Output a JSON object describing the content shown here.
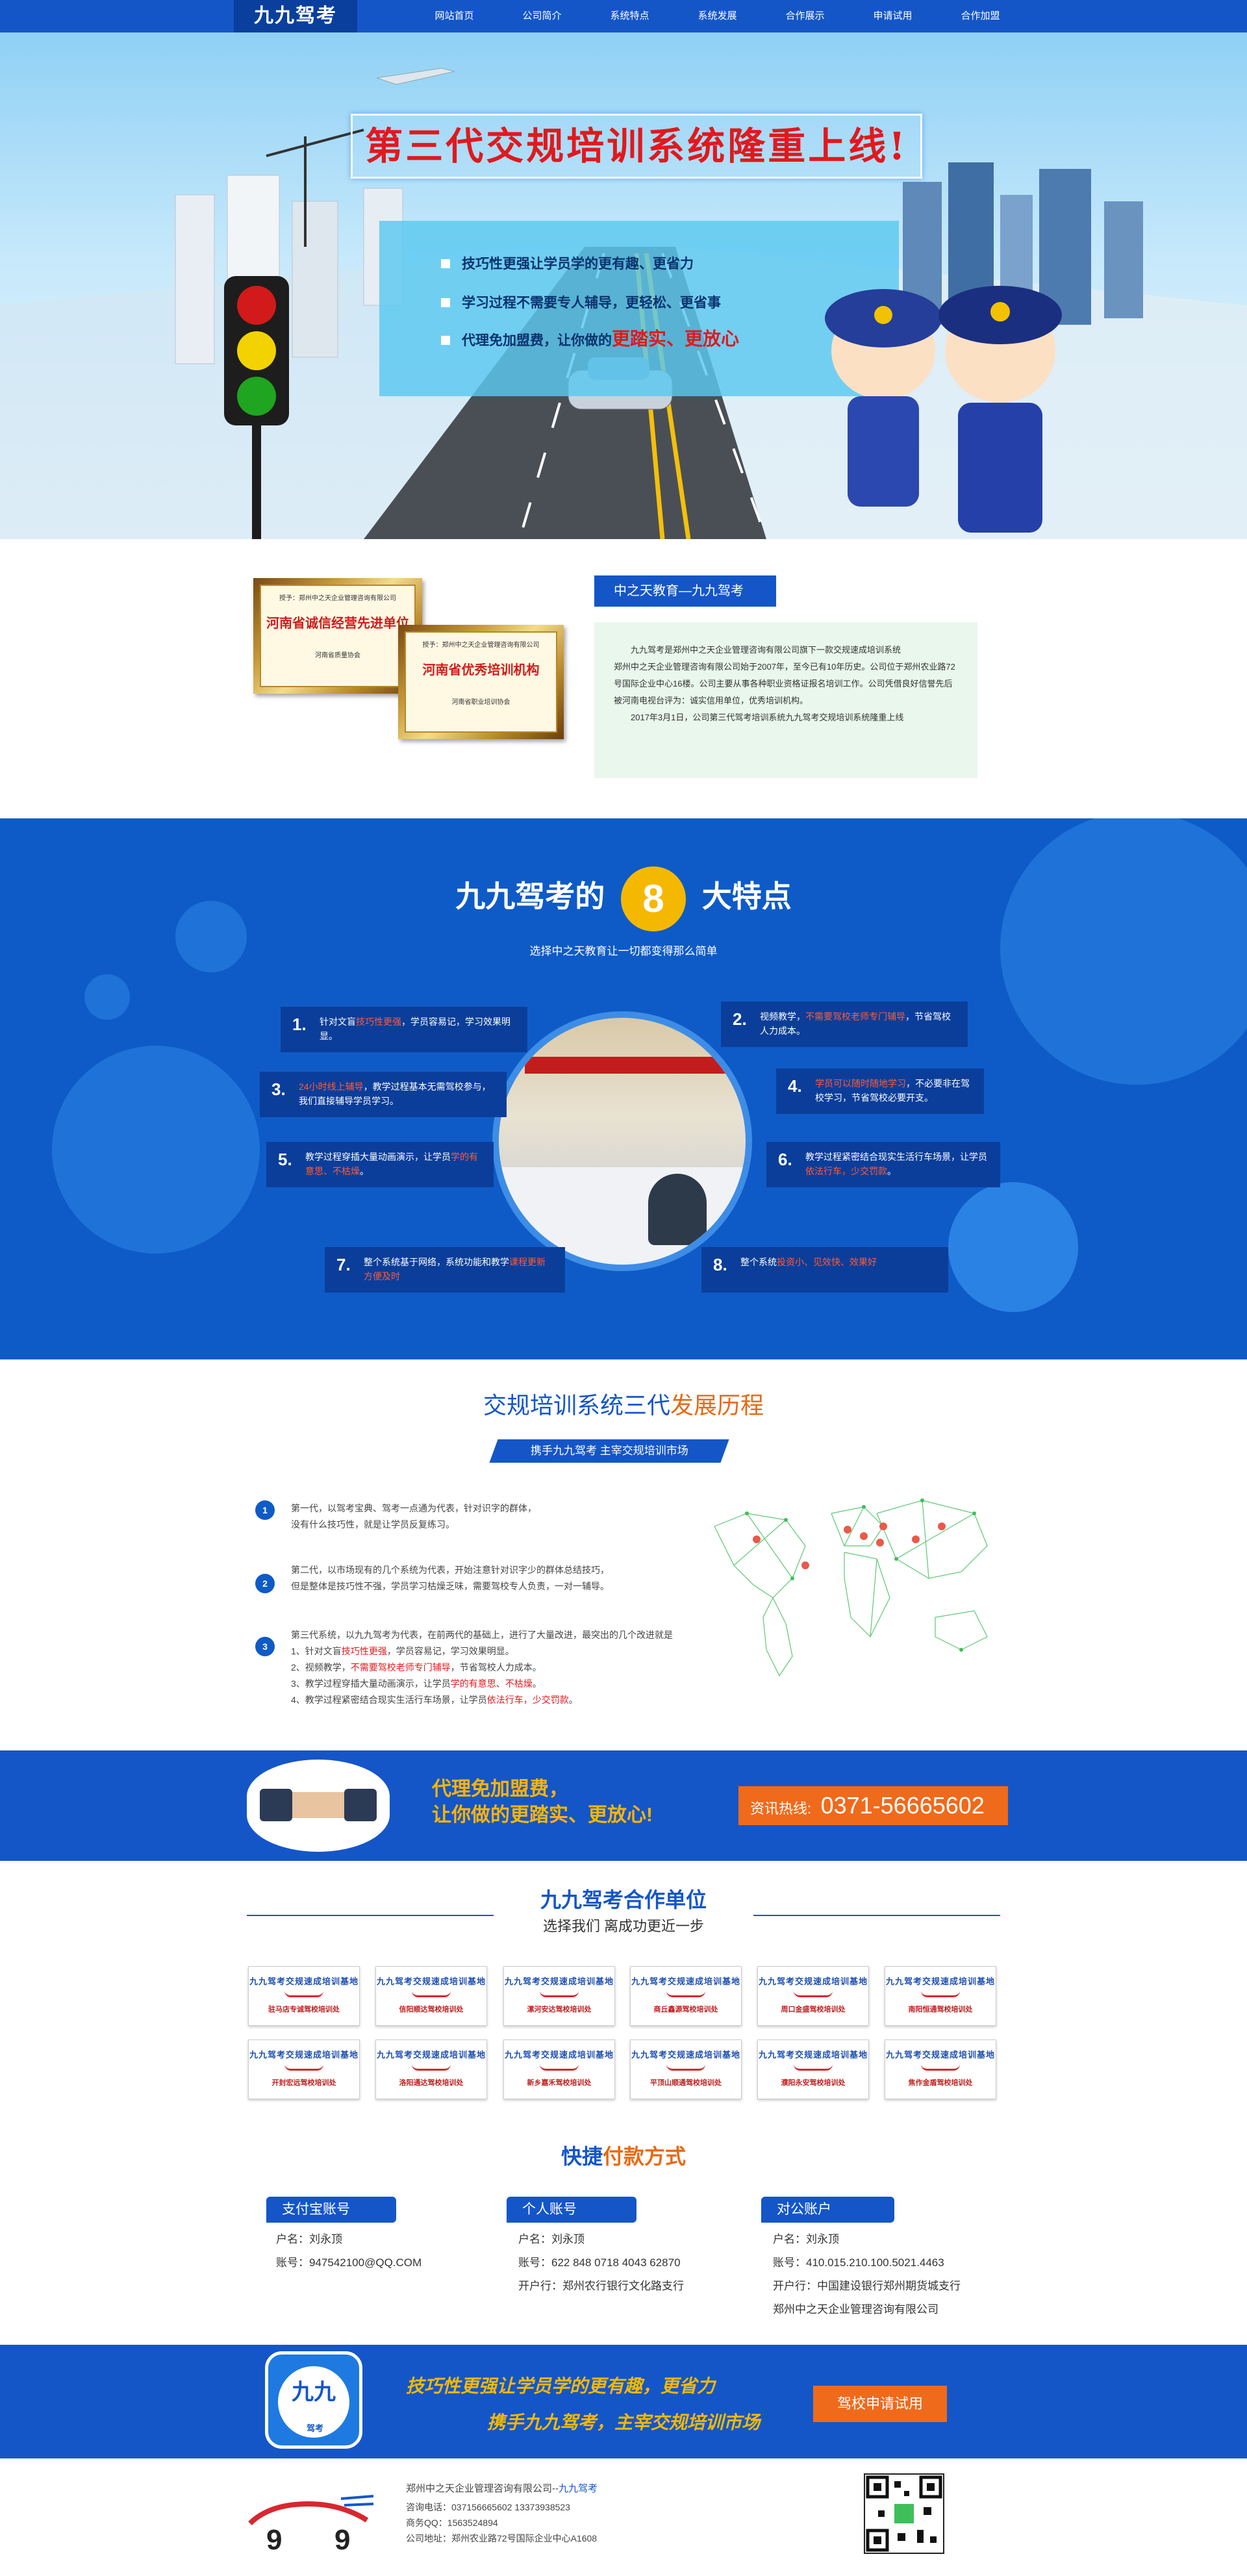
{
  "nav": {
    "logo": "九九驾考",
    "items": [
      "网站首页",
      "公司简介",
      "系统特点",
      "系统发展",
      "合作展示",
      "申请试用",
      "合作加盟"
    ]
  },
  "banner": {
    "title": "第三代交规培训系统隆重上线!",
    "points": [
      {
        "text": "技巧性更强让学员学的更有趣、更省力",
        "em": ""
      },
      {
        "text": "学习过程不需要专人辅导，更轻松、更省事",
        "em": ""
      },
      {
        "text": "代理免加盟费，让你做的",
        "em": "更踏实、更放心"
      }
    ]
  },
  "intro": {
    "heading": "中之天教育—九九驾考",
    "cert1": {
      "small": "授予：郑州中之天企业管理咨询有限公司",
      "big": "河南省诚信经营先进单位",
      "issuer": "河南省质量协会"
    },
    "cert2": {
      "small": "授予：郑州中之天企业管理咨询有限公司",
      "big": "河南省优秀培训机构",
      "issuer": "河南省职业培训协会"
    },
    "paragraphs": [
      "九九驾考是郑州中之天企业管理咨询有限公司旗下一款交规速成培训系统",
      "郑州中之天企业管理咨询有限公司始于2007年，至今已有10年历史。公司位于郑州农业路72号国际企业中心16楼。公司主要从事各种职业资格证报名培训工作。公司凭借良好信誉先后被河南电视台评为：诚实信用单位，优秀培训机构。",
      "2017年3月1日，公司第三代驾考培训系统九九驾考交规培训系统隆重上线"
    ]
  },
  "features": {
    "title_pre": "九九驾考的",
    "title_num": "8",
    "title_post": "大特点",
    "subtitle": "选择中之天教育让一切都变得那么简单",
    "items": [
      {
        "n": "1.",
        "a": "针对文盲",
        "r": "技巧性更强",
        "b": "，学员容易记，学习效果明显。"
      },
      {
        "n": "2.",
        "a": "视频教学，",
        "r": "不需要驾校老师专门辅导",
        "b": "，节省驾校人力成本。"
      },
      {
        "n": "3.",
        "a": "",
        "r": "24小时线上辅导",
        "b": "，教学过程基本无需驾校参与，我们直接辅导学员学习。"
      },
      {
        "n": "4.",
        "a": "",
        "r": "学员可以随时随地学习",
        "b": "，不必要非在驾校学习，节省驾校必要开支。"
      },
      {
        "n": "5.",
        "a": "教学过程穿插大量动画演示，让学员",
        "r": "学的有意思、不枯燥",
        "b": "。"
      },
      {
        "n": "6.",
        "a": "教学过程紧密结合现实生活行车场景，让学员",
        "r": "依法行车，少交罚款",
        "b": "。"
      },
      {
        "n": "7.",
        "a": "整个系统基于网络，系统功能和教学",
        "r": "课程更新方便及时",
        "b": ""
      },
      {
        "n": "8.",
        "a": "整个系统",
        "r": "投资小、见效快、效果好",
        "b": ""
      }
    ]
  },
  "history": {
    "title_a": "交规培训系统三代",
    "title_b": "发展历程",
    "ribbon": "携手九九驾考 主宰交规培训市场",
    "gen": [
      {
        "n": "1",
        "lines": [
          "第一代，以驾考宝典、驾考一点通为代表，针对识字的群体，",
          "没有什么技巧性，就是让学员反复练习。"
        ]
      },
      {
        "n": "2",
        "lines": [
          "第二代，以市场现有的几个系统为代表，开始注意针对识字少的群体总结技巧，",
          "但是整体是技巧性不强，学员学习枯燥乏味，需要驾校专人负责，一对一辅导。"
        ]
      },
      {
        "n": "3",
        "lines": [
          "第三代系统，以九九驾考为代表，在前两代的基础上，进行了大量改进，最突出的几个改进就是"
        ],
        "sub": [
          {
            "a": "1、针对文盲",
            "r": "技巧性更强",
            "b": "，学员容易记，学习效果明显。"
          },
          {
            "a": "2、视频教学，",
            "r": "不需要驾校老师专门辅导",
            "b": "，节省驾校人力成本。"
          },
          {
            "a": "3、教学过程穿插大量动画演示，让学员",
            "r": "学的有意思、不枯燥",
            "b": "。"
          },
          {
            "a": "4、教学过程紧密结合现实生活行车场景，让学员",
            "r": "依法行车，少交罚款",
            "b": "。"
          }
        ]
      }
    ]
  },
  "hotline": {
    "slogan1": "代理免加盟费，",
    "slogan2": "让你做的更踏实、更放心!",
    "label": "资讯热线:",
    "number": "0371-56665602"
  },
  "partners": {
    "title": "九九驾考合作单位",
    "subtitle": "选择我们 离成功更近一步",
    "card_top": "九九驾考交规速成培训基地",
    "names": [
      "驻马店专诚驾校培训处",
      "信阳顺达驾校培训处",
      "漯河安达驾校培训处",
      "商丘鑫源驾校培训处",
      "周口金盛驾校培训处",
      "南阳恒通驾校培训处",
      "开封宏远驾校培训处",
      "洛阳通达驾校培训处",
      "新乡嘉禾驾校培训处",
      "平顶山顺通驾校培训处",
      "濮阳永安驾校培训处",
      "焦作金盾驾校培训处"
    ]
  },
  "payment": {
    "title_a": "快捷",
    "title_b": "付款方式",
    "cols": [
      {
        "tag": "支付宝账号",
        "lines": [
          "户名：刘永顶",
          "账号：947542100@QQ.COM"
        ]
      },
      {
        "tag": "个人账号",
        "lines": [
          "户名：刘永顶",
          "账号：622 848 0718 4043 62870",
          "开户行：郑州农行银行文化路支行"
        ]
      },
      {
        "tag": "对公账户",
        "lines": [
          "户名：刘永顶",
          "账号：410.015.210.100.5021.4463",
          "开户行：中国建设银行郑州期货城支行",
          "郑州中之天企业管理咨询有限公司"
        ]
      }
    ]
  },
  "cta": {
    "badge": "九九",
    "badge_sub": "驾考",
    "line1": "技巧性更强让学员学的更有趣，更省力",
    "line2": "携手九九驾考，主宰交规培训市场",
    "button": "驾校申请试用"
  },
  "footer": {
    "company": "郑州中之天企业管理咨询有限公司--",
    "brand": "九九驾考",
    "lines": [
      "咨询电话：037156665602  13373938523",
      "商务QQ：1563524894",
      "公司地址：郑州农业路72号国际企业中心A1608"
    ]
  },
  "colors": {
    "primary": "#1456c8",
    "accent": "#e0191d",
    "orange": "#f06a1b",
    "yellow": "#f5b800"
  }
}
